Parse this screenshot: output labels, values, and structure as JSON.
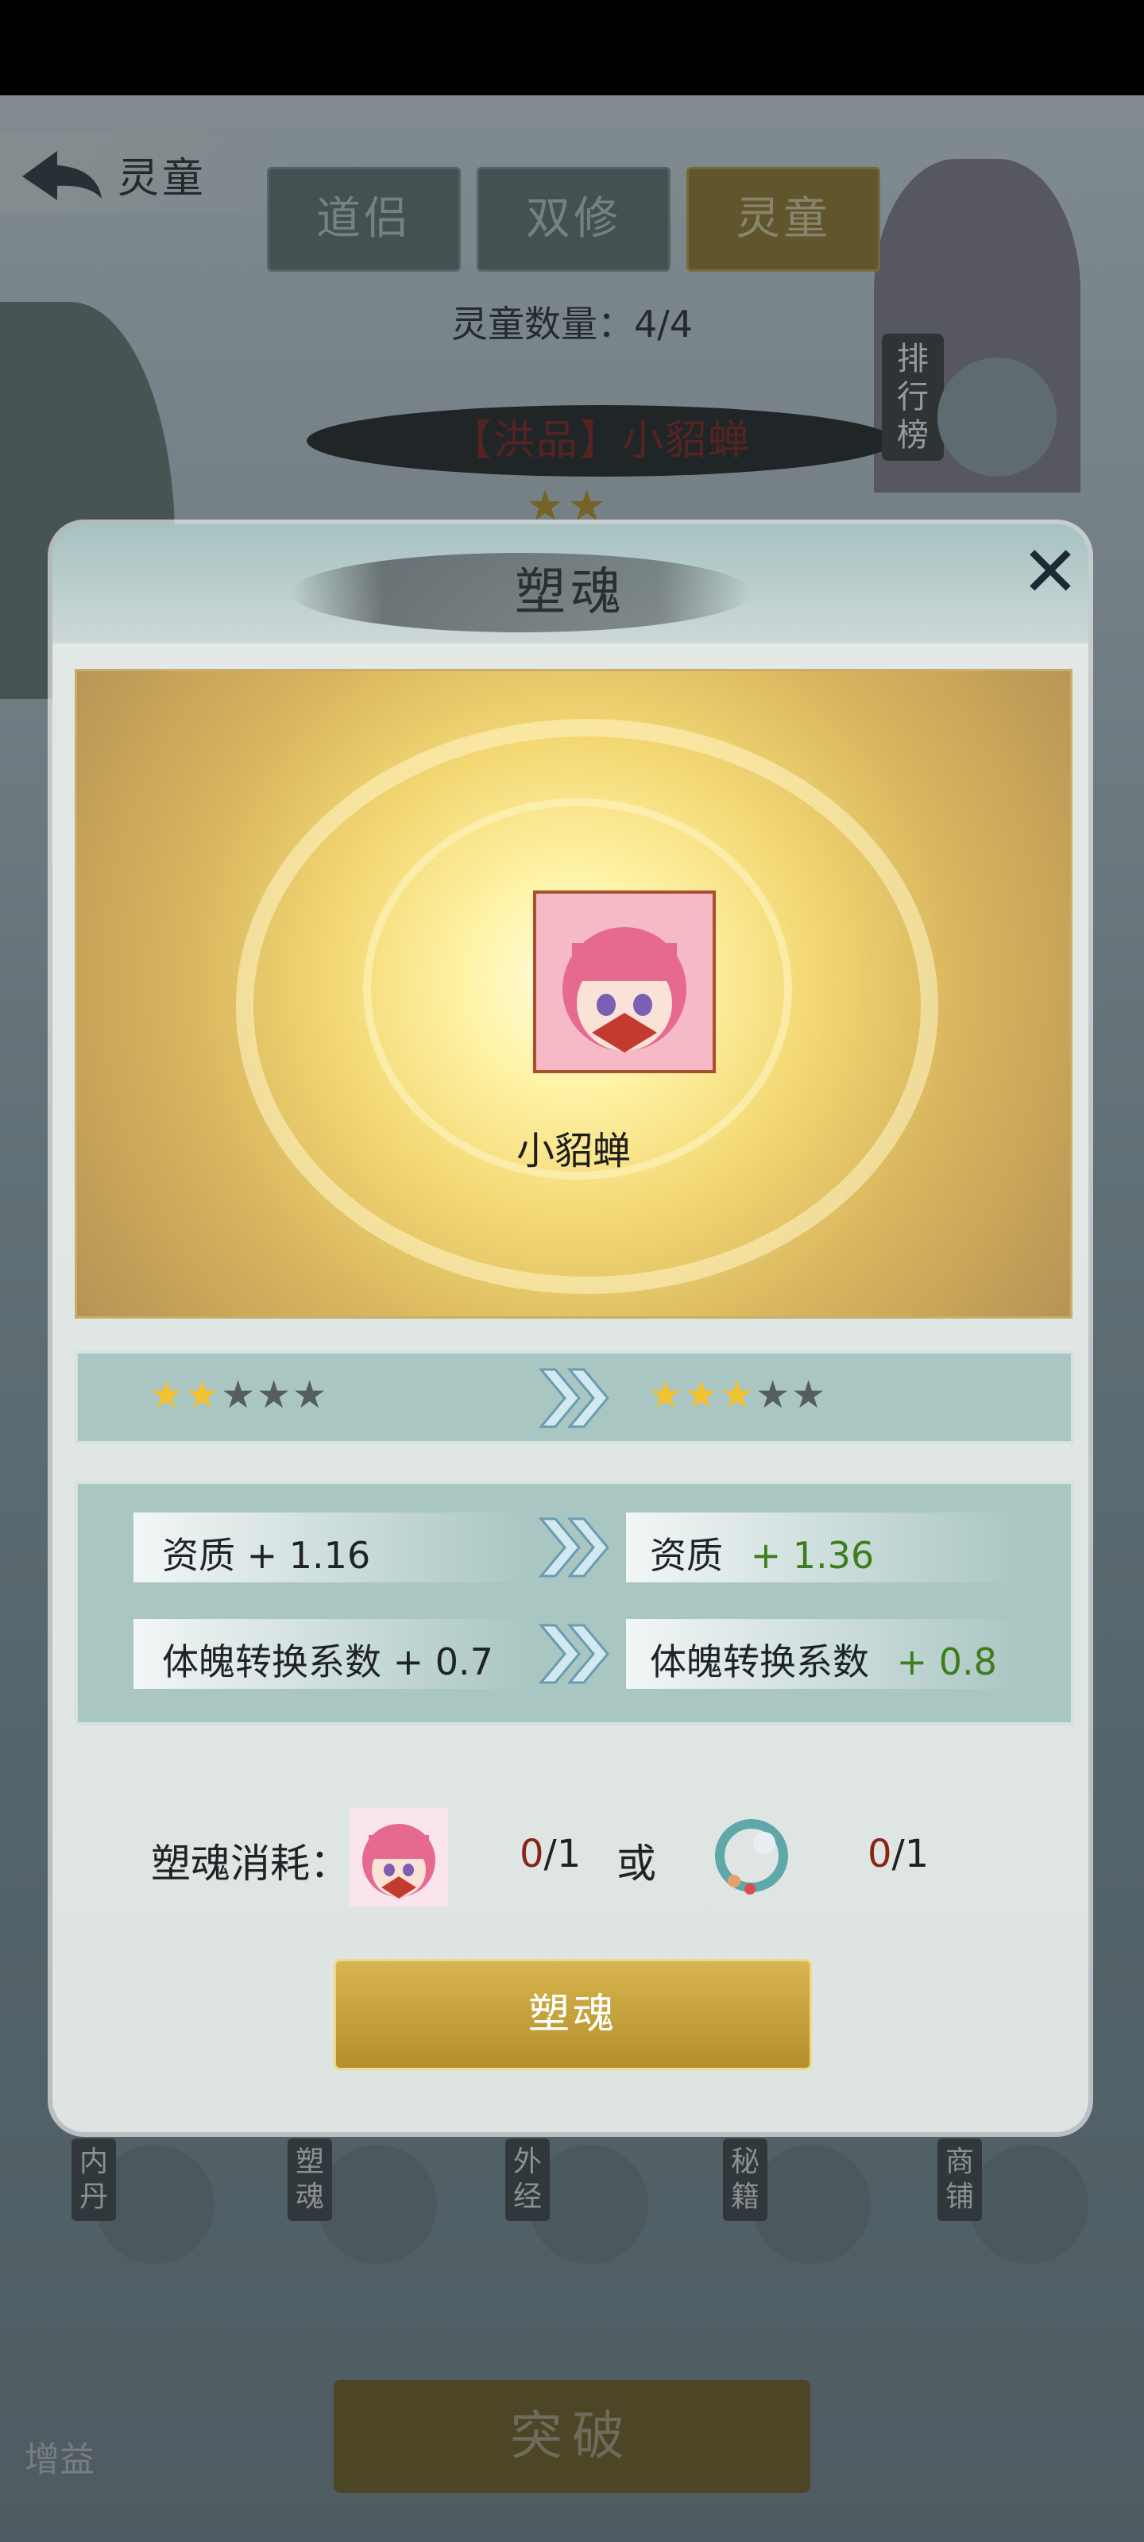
{
  "header": {
    "back_title": "灵童",
    "tabs": [
      {
        "label": "道侣",
        "active": false
      },
      {
        "label": "双修",
        "active": false
      },
      {
        "label": "灵童",
        "active": true
      }
    ],
    "count_text": "灵童数量：4/4",
    "nameplate": "【洪品】小貂蝉",
    "rank_label": "排行榜"
  },
  "modal": {
    "title": "塑魂",
    "close_label": "✕",
    "character_name": "小貂蝉",
    "stars_before": {
      "filled": 2,
      "total": 5
    },
    "stars_after": {
      "filled": 3,
      "total": 5
    },
    "stats": [
      {
        "label": "资质 + 1.16",
        "new_label": "资质",
        "new_value": "+ 1.36"
      },
      {
        "label": "体魄转换系数 + 0.7",
        "new_label": "体魄转换系数",
        "new_value": "+ 0.8"
      }
    ],
    "cost": {
      "label": "塑魂消耗：",
      "item1_have": "0",
      "item1_need": "/1",
      "or": "或",
      "item2_have": "0",
      "item2_need": "/1"
    },
    "action_button": "塑魂"
  },
  "bottom": {
    "nav": [
      {
        "label": "内丹",
        "icon": "yin-yang-icon"
      },
      {
        "label": "塑魂",
        "icon": "swirl-icon"
      },
      {
        "label": "外经",
        "icon": "scroll-icon"
      },
      {
        "label": "秘籍",
        "icon": "book-icon"
      },
      {
        "label": "商铺",
        "icon": "shop-icon"
      }
    ],
    "breakthrough": "突破",
    "boost": "增益"
  },
  "colors": {
    "gold": "#b38f2a",
    "green": "#3d7d1c",
    "red": "#8a2418",
    "panel": "#a9c6c3"
  }
}
